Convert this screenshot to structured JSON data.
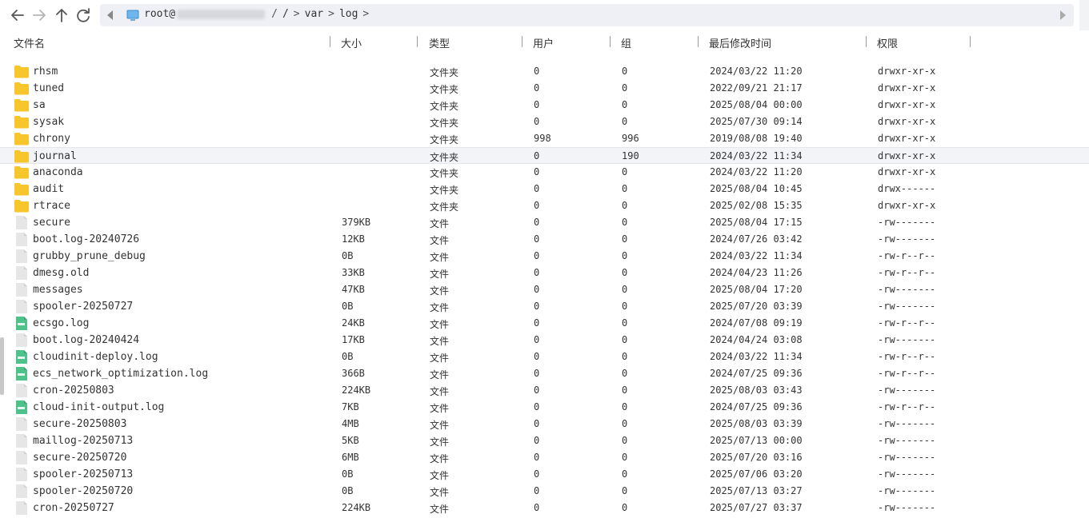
{
  "toolbar": {
    "back_icon": "arrow-left-icon",
    "forward_icon": "arrow-right-icon",
    "up_icon": "arrow-up-icon",
    "refresh_icon": "refresh-icon"
  },
  "address": {
    "host_prefix": "root@",
    "host_suffix": "",
    "root_sep": "/",
    "segments": [
      "var",
      "log"
    ]
  },
  "columns": {
    "name": "文件名",
    "size": "大小",
    "type": "类型",
    "user": "用户",
    "group": "组",
    "mtime": "最后修改时间",
    "perm": "权限"
  },
  "colors": {
    "folder": "#f7c52c",
    "file": "#e6e6e6",
    "logfile": "#4fc28b",
    "selected_row": "#f3f4f8"
  },
  "files": [
    {
      "name": "rhsm",
      "size": "",
      "type": "文件夹",
      "user": "0",
      "group": "0",
      "mtime": "2024/03/22 11:20",
      "perm": "drwxr-xr-x",
      "icon": "folder"
    },
    {
      "name": "tuned",
      "size": "",
      "type": "文件夹",
      "user": "0",
      "group": "0",
      "mtime": "2022/09/21 21:17",
      "perm": "drwxr-xr-x",
      "icon": "folder"
    },
    {
      "name": "sa",
      "size": "",
      "type": "文件夹",
      "user": "0",
      "group": "0",
      "mtime": "2025/08/04 00:00",
      "perm": "drwxr-xr-x",
      "icon": "folder"
    },
    {
      "name": "sysak",
      "size": "",
      "type": "文件夹",
      "user": "0",
      "group": "0",
      "mtime": "2025/07/30 09:14",
      "perm": "drwxr-xr-x",
      "icon": "folder"
    },
    {
      "name": "chrony",
      "size": "",
      "type": "文件夹",
      "user": "998",
      "group": "996",
      "mtime": "2019/08/08 19:40",
      "perm": "drwxr-xr-x",
      "icon": "folder"
    },
    {
      "name": "journal",
      "size": "",
      "type": "文件夹",
      "user": "0",
      "group": "190",
      "mtime": "2024/03/22 11:34",
      "perm": "drwxr-xr-x",
      "icon": "folder",
      "selected": true
    },
    {
      "name": "anaconda",
      "size": "",
      "type": "文件夹",
      "user": "0",
      "group": "0",
      "mtime": "2024/03/22 11:20",
      "perm": "drwxr-xr-x",
      "icon": "folder"
    },
    {
      "name": "audit",
      "size": "",
      "type": "文件夹",
      "user": "0",
      "group": "0",
      "mtime": "2025/08/04 10:45",
      "perm": "drwx------",
      "icon": "folder"
    },
    {
      "name": "rtrace",
      "size": "",
      "type": "文件夹",
      "user": "0",
      "group": "0",
      "mtime": "2025/02/08 15:35",
      "perm": "drwxr-xr-x",
      "icon": "folder"
    },
    {
      "name": "secure",
      "size": "379KB",
      "type": "文件",
      "user": "0",
      "group": "0",
      "mtime": "2025/08/04 17:15",
      "perm": "-rw-------",
      "icon": "file"
    },
    {
      "name": "boot.log-20240726",
      "size": "12KB",
      "type": "文件",
      "user": "0",
      "group": "0",
      "mtime": "2024/07/26 03:42",
      "perm": "-rw-------",
      "icon": "file"
    },
    {
      "name": "grubby_prune_debug",
      "size": "0B",
      "type": "文件",
      "user": "0",
      "group": "0",
      "mtime": "2024/03/22 11:34",
      "perm": "-rw-r--r--",
      "icon": "file"
    },
    {
      "name": "dmesg.old",
      "size": "33KB",
      "type": "文件",
      "user": "0",
      "group": "0",
      "mtime": "2024/04/23 11:26",
      "perm": "-rw-r--r--",
      "icon": "file"
    },
    {
      "name": "messages",
      "size": "47KB",
      "type": "文件",
      "user": "0",
      "group": "0",
      "mtime": "2025/08/04 17:20",
      "perm": "-rw-------",
      "icon": "file"
    },
    {
      "name": "spooler-20250727",
      "size": "0B",
      "type": "文件",
      "user": "0",
      "group": "0",
      "mtime": "2025/07/20 03:39",
      "perm": "-rw-------",
      "icon": "file"
    },
    {
      "name": "ecsgo.log",
      "size": "24KB",
      "type": "文件",
      "user": "0",
      "group": "0",
      "mtime": "2024/07/08 09:19",
      "perm": "-rw-r--r--",
      "icon": "log"
    },
    {
      "name": "boot.log-20240424",
      "size": "17KB",
      "type": "文件",
      "user": "0",
      "group": "0",
      "mtime": "2024/04/24 03:08",
      "perm": "-rw-------",
      "icon": "file"
    },
    {
      "name": "cloudinit-deploy.log",
      "size": "0B",
      "type": "文件",
      "user": "0",
      "group": "0",
      "mtime": "2024/03/22 11:34",
      "perm": "-rw-r--r--",
      "icon": "log"
    },
    {
      "name": "ecs_network_optimization.log",
      "size": "366B",
      "type": "文件",
      "user": "0",
      "group": "0",
      "mtime": "2024/07/25 09:36",
      "perm": "-rw-r--r--",
      "icon": "log"
    },
    {
      "name": "cron-20250803",
      "size": "224KB",
      "type": "文件",
      "user": "0",
      "group": "0",
      "mtime": "2025/08/03 03:43",
      "perm": "-rw-------",
      "icon": "file"
    },
    {
      "name": "cloud-init-output.log",
      "size": "7KB",
      "type": "文件",
      "user": "0",
      "group": "0",
      "mtime": "2024/07/25 09:36",
      "perm": "-rw-r--r--",
      "icon": "log"
    },
    {
      "name": "secure-20250803",
      "size": "4MB",
      "type": "文件",
      "user": "0",
      "group": "0",
      "mtime": "2025/08/03 03:39",
      "perm": "-rw-------",
      "icon": "file"
    },
    {
      "name": "maillog-20250713",
      "size": "5KB",
      "type": "文件",
      "user": "0",
      "group": "0",
      "mtime": "2025/07/13 00:00",
      "perm": "-rw-------",
      "icon": "file"
    },
    {
      "name": "secure-20250720",
      "size": "6MB",
      "type": "文件",
      "user": "0",
      "group": "0",
      "mtime": "2025/07/20 03:16",
      "perm": "-rw-------",
      "icon": "file"
    },
    {
      "name": "spooler-20250713",
      "size": "0B",
      "type": "文件",
      "user": "0",
      "group": "0",
      "mtime": "2025/07/06 03:20",
      "perm": "-rw-------",
      "icon": "file"
    },
    {
      "name": "spooler-20250720",
      "size": "0B",
      "type": "文件",
      "user": "0",
      "group": "0",
      "mtime": "2025/07/13 03:27",
      "perm": "-rw-------",
      "icon": "file"
    },
    {
      "name": "cron-20250727",
      "size": "224KB",
      "type": "文件",
      "user": "0",
      "group": "0",
      "mtime": "2025/07/27 03:37",
      "perm": "-rw-------",
      "icon": "file"
    }
  ]
}
